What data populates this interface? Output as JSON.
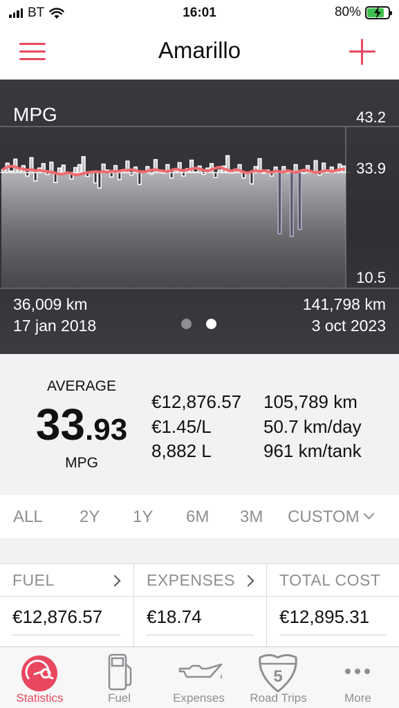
{
  "status_bar": {
    "carrier": "BT",
    "time": "16:01",
    "battery_percent": "80%",
    "battery_level": 0.8
  },
  "nav": {
    "title": "Amarillo",
    "menu_icon": "hamburger-menu-icon",
    "add_icon": "plus-icon"
  },
  "chart_data": {
    "type": "bar",
    "title": "MPG",
    "y_ticks": [
      "43.2",
      "33.9",
      "10.5"
    ],
    "ylim": [
      10.5,
      43.2
    ],
    "average": 33.9,
    "x_start": {
      "distance": "36,009 km",
      "date": "17 jan 2018"
    },
    "x_end": {
      "distance": "141,798 km",
      "date": "3 oct 2023"
    },
    "series": [
      {
        "name": "",
        "role": "fill-up",
        "values": [
          34.5,
          35.8,
          34.2,
          36.6,
          34.8,
          35.3,
          33.2,
          36.9,
          32.2,
          34.8,
          35.7,
          33.5,
          36.0,
          31.9,
          34.8,
          35.4,
          33.7,
          32.6,
          34.9,
          35.5,
          37.1,
          33.1,
          34.0,
          31.8,
          30.8,
          35.6,
          34.4,
          33.0,
          35.3,
          32.5,
          34.5,
          36.2,
          33.4,
          35.0,
          31.5,
          34.2,
          35.1,
          33.6,
          36.5,
          34.0,
          33.8,
          35.5,
          32.8,
          34.3,
          35.9,
          33.2,
          34.7,
          36.4,
          34.0,
          35.2,
          33.5,
          34.8,
          35.7,
          32.9,
          34.4,
          35.2,
          37.3,
          33.8,
          34.6,
          35.5,
          32.8,
          34.0,
          31.6,
          35.1,
          36.7,
          33.9,
          34.4,
          33.2,
          35.0,
          21.5,
          35.1,
          34.2,
          21.0,
          35.5,
          22.4,
          33.9,
          35.3,
          34.2,
          36.3,
          33.4,
          35.8,
          34.1,
          35.0,
          34.4,
          35.6,
          35.2
        ]
      },
      {
        "name": "",
        "role": "trend",
        "values": [
          34.6,
          35.0,
          35.2,
          35.0,
          34.7,
          34.6,
          34.4,
          34.5,
          34.3,
          34.4,
          34.2,
          34.1,
          34.0,
          33.8,
          33.6,
          33.6,
          33.9,
          33.7,
          33.4,
          33.5,
          33.7,
          33.9,
          34.0,
          34.1,
          34.0,
          34.1,
          34.0,
          34.2,
          34.1,
          34.2,
          34.4,
          34.3,
          34.5,
          34.3,
          34.1,
          34.0,
          34.2,
          34.4,
          34.5,
          34.3,
          34.2,
          34.1,
          34.4,
          34.6,
          34.4,
          34.3,
          34.5,
          34.6,
          34.8,
          34.6,
          34.4,
          34.2,
          34.5,
          34.8,
          35.0,
          34.7,
          34.4,
          34.2,
          34.5,
          34.3,
          34.0,
          33.8,
          34.1,
          34.3,
          34.1,
          34.3,
          34.1,
          33.9,
          34.2,
          34.1,
          34.0,
          34.3,
          34.1,
          33.9,
          34.2,
          34.4,
          34.3,
          34.1,
          33.9,
          34.0,
          34.2,
          34.3,
          34.1,
          34.3,
          34.5,
          34.6
        ]
      }
    ],
    "page_dots": 2,
    "active_page": 1
  },
  "summary": {
    "average_label": "AVERAGE",
    "average_int": "33",
    "average_dec": ".93",
    "average_unit": "MPG",
    "col_a": [
      "€12,876.57",
      "€1.45/L",
      "8,882 L"
    ],
    "col_b": [
      "105,789 km",
      "50.7 km/day",
      "961 km/tank"
    ]
  },
  "range_tabs": [
    {
      "label": "ALL",
      "active": true
    },
    {
      "label": "2Y",
      "active": false
    },
    {
      "label": "1Y",
      "active": false
    },
    {
      "label": "6M",
      "active": false
    },
    {
      "label": "3M",
      "active": false
    },
    {
      "label": "CUSTOM",
      "active": false
    }
  ],
  "costs": {
    "fuel": {
      "label": "FUEL",
      "value": "€12,876.57"
    },
    "expenses": {
      "label": "EXPENSES",
      "value": "€18.74"
    },
    "total": {
      "label": "TOTAL COST",
      "value": "€12,895.31"
    }
  },
  "tab_bar": [
    {
      "label": "Statistics",
      "icon": "statistics-gauge-icon",
      "active": true
    },
    {
      "label": "Fuel",
      "icon": "fuel-pump-icon",
      "active": false
    },
    {
      "label": "Expenses",
      "icon": "oil-can-icon",
      "active": false
    },
    {
      "label": "Road Trips",
      "icon": "road-sign-icon",
      "active": false,
      "badge": "5"
    },
    {
      "label": "More",
      "icon": "more-dots-icon",
      "active": false
    }
  ],
  "colors": {
    "accent": "#e8475f",
    "chart_bg": "#333236",
    "trend_line": "#ef6b6f",
    "battery": "#3ec24f"
  }
}
